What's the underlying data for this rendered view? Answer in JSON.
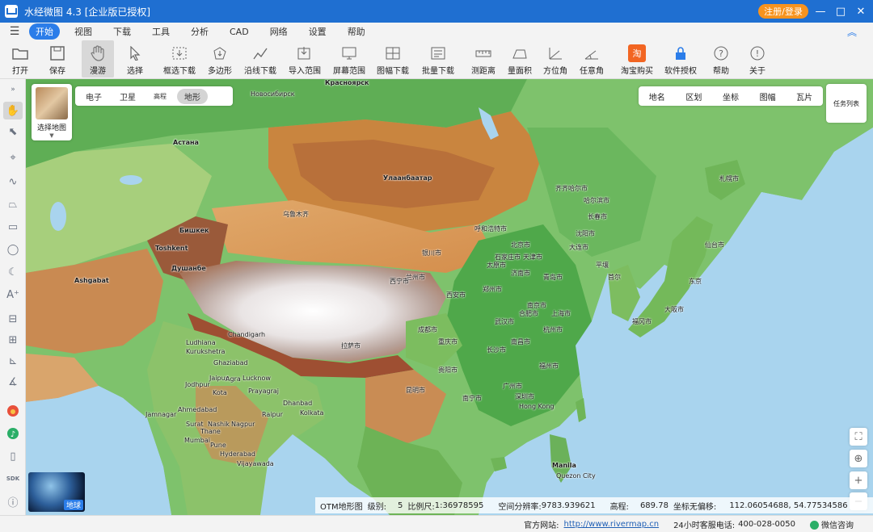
{
  "titlebar": {
    "title": "水经微图 4.3 [企业版已授权]",
    "login_label": "注册/登录",
    "minimize": "—",
    "maximize": "□",
    "close": "✕"
  },
  "menubar": {
    "items": [
      "开始",
      "视图",
      "下载",
      "工具",
      "分析",
      "CAD",
      "网络",
      "设置",
      "帮助"
    ],
    "active": "开始"
  },
  "toolbar": {
    "items": [
      {
        "label": "打开",
        "icon": "folder-icon"
      },
      {
        "label": "保存",
        "icon": "save-icon"
      },
      {
        "label": "漫游",
        "icon": "hand-icon"
      },
      {
        "label": "选择",
        "icon": "cursor-icon"
      },
      {
        "label": "框选下载",
        "icon": "box-download-icon"
      },
      {
        "label": "多边形",
        "icon": "polygon-download-icon"
      },
      {
        "label": "沿线下载",
        "icon": "line-download-icon"
      },
      {
        "label": "导入范围",
        "icon": "import-icon"
      },
      {
        "label": "屏幕范围",
        "icon": "screen-icon"
      },
      {
        "label": "图幅下载",
        "icon": "sheet-download-icon"
      },
      {
        "label": "批量下载",
        "icon": "batch-download-icon"
      },
      {
        "label": "测距离",
        "icon": "ruler-icon"
      },
      {
        "label": "量面积",
        "icon": "area-icon"
      },
      {
        "label": "方位角",
        "icon": "azimuth-icon"
      },
      {
        "label": "任意角",
        "icon": "angle-icon"
      },
      {
        "label": "淘宝购买",
        "icon": "taobao-icon"
      },
      {
        "label": "软件授权",
        "icon": "lock-icon"
      },
      {
        "label": "帮助",
        "icon": "help-icon"
      },
      {
        "label": "关于",
        "icon": "info-icon"
      }
    ],
    "selected": "漫游",
    "taobao_glyph": "淘"
  },
  "map": {
    "chooser_label": "选择地图",
    "types": [
      "电子",
      "卫星",
      "高程",
      "地形"
    ],
    "active_type": "地形",
    "layers": [
      "地名",
      "区划",
      "坐标",
      "图幅",
      "瓦片"
    ],
    "task_list": "任务列表",
    "globe_label": "地球",
    "places": [
      {
        "name": "Красноярск"
      },
      {
        "name": "Новосибирск"
      },
      {
        "name": "Астана"
      },
      {
        "name": "Улаанбаатар"
      },
      {
        "name": "Бишкек"
      },
      {
        "name": "Toshkent"
      },
      {
        "name": "Душанбе"
      },
      {
        "name": "Ashgabat"
      },
      {
        "name": "乌鲁木齐"
      },
      {
        "name": "Chandigarh"
      },
      {
        "name": "Ludhiana"
      },
      {
        "name": "Kurukshetra"
      },
      {
        "name": "Ghaziabad"
      },
      {
        "name": "Jaipur"
      },
      {
        "name": "Agra"
      },
      {
        "name": "Lucknow"
      },
      {
        "name": "Jodhpur"
      },
      {
        "name": "Kota"
      },
      {
        "name": "Prayagraj"
      },
      {
        "name": "Ahmedabad"
      },
      {
        "name": "Dhanbad"
      },
      {
        "name": "Kolkata"
      },
      {
        "name": "Surat"
      },
      {
        "name": "Nashik"
      },
      {
        "name": "Thane"
      },
      {
        "name": "Mumbai"
      },
      {
        "name": "Pune"
      },
      {
        "name": "Nagpur"
      },
      {
        "name": "Raipur"
      },
      {
        "name": "Hyderabad"
      },
      {
        "name": "Vijayawada"
      },
      {
        "name": "Jamnagar"
      },
      {
        "name": "Hong Kong"
      },
      {
        "name": "Manila"
      },
      {
        "name": "Quezon City"
      },
      {
        "name": "齐齐哈尔市"
      },
      {
        "name": "哈尔滨市"
      },
      {
        "name": "长春市"
      },
      {
        "name": "沈阳市"
      },
      {
        "name": "北京市"
      },
      {
        "name": "天津市"
      },
      {
        "name": "大连市"
      },
      {
        "name": "济南市"
      },
      {
        "name": "青岛市"
      },
      {
        "name": "郑州市"
      },
      {
        "name": "西安市"
      },
      {
        "name": "南京市"
      },
      {
        "name": "上海市"
      },
      {
        "name": "武汉市"
      },
      {
        "name": "成都市"
      },
      {
        "name": "重庆市"
      },
      {
        "name": "长沙市"
      },
      {
        "name": "杭州市"
      },
      {
        "name": "福州市"
      },
      {
        "name": "广州市"
      },
      {
        "name": "深圳市"
      },
      {
        "name": "昆明市"
      },
      {
        "name": "南宁市"
      },
      {
        "name": "兰州市"
      },
      {
        "name": "银川市"
      },
      {
        "name": "呼和浩特市"
      },
      {
        "name": "太原市"
      },
      {
        "name": "石家庄市"
      },
      {
        "name": "合肥市"
      },
      {
        "name": "南昌市"
      },
      {
        "name": "贵阳市"
      },
      {
        "name": "拉萨市"
      },
      {
        "name": "西宁市"
      },
      {
        "name": "札幌市"
      },
      {
        "name": "仙台市"
      },
      {
        "name": "东京"
      },
      {
        "name": "大阪市"
      },
      {
        "name": "福冈市"
      },
      {
        "name": "首尔"
      },
      {
        "name": "平壤"
      }
    ],
    "info": {
      "map_name": "OTM地形图",
      "level_label": "级别:",
      "level": "5",
      "scale_label": "比例尺:",
      "scale": "1:36978595",
      "resolution_label": "空间分辨率:",
      "resolution": "9783.939621",
      "elevation_label": "高程:",
      "elevation": "689.78",
      "coord_label": "坐标无偏移:",
      "coord": "112.06054688, 54.77534586"
    }
  },
  "statusbar": {
    "site_label": "官方网站:",
    "site_url": "http://www.rivermap.cn",
    "phone_label": "24小时客服电话:",
    "phone": "400-028-0050",
    "wechat": "微信咨询"
  },
  "colors": {
    "titlebar": "#1f6fd1",
    "accent": "#2b7de9",
    "login": "#f7931e"
  }
}
